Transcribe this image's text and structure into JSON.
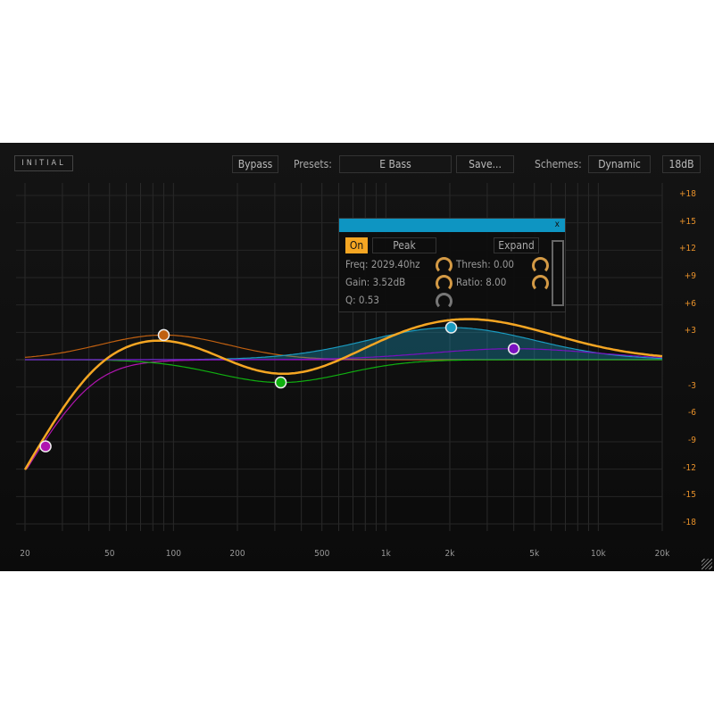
{
  "header": {
    "logo": "INITIAL",
    "bypass": "Bypass",
    "presets_label": "Presets:",
    "preset_value": "E Bass",
    "save": "Save...",
    "schemes_label": "Schemes:",
    "scheme_value": "Dynamic",
    "range": "18dB"
  },
  "popup": {
    "close": "x",
    "on": "On",
    "type": "Peak",
    "expand": "Expand",
    "freq": "Freq: 2029.40hz",
    "gain": "Gain: 3.52dB",
    "q": "Q: 0.53",
    "thresh": "Thresh: 0.00",
    "ratio": "Ratio: 8.00"
  },
  "db_labels": [
    "+18",
    "+15",
    "+12",
    "+9",
    "+6",
    "+3",
    "-3",
    "-6",
    "-9",
    "-12",
    "-15",
    "-18"
  ],
  "freq_labels": [
    "20",
    "50",
    "100",
    "200",
    "500",
    "1k",
    "2k",
    "5k",
    "10k",
    "20k"
  ],
  "bands": [
    {
      "type": "highpass",
      "freq": 40,
      "gain": -9.5,
      "color": "#b015b0"
    },
    {
      "type": "peak",
      "freq": 90,
      "gain": 2.7,
      "color": "#c06010"
    },
    {
      "type": "peak",
      "freq": 320,
      "gain": -2.5,
      "color": "#10b010"
    },
    {
      "type": "peak",
      "freq": 2029.4,
      "gain": 3.52,
      "color": "#1a9bc0"
    },
    {
      "type": "peak",
      "freq": 4000,
      "gain": 1.2,
      "color": "#7a10c0"
    }
  ],
  "colors": {
    "accent": "#f5a623",
    "sum_curve": "#f5a623"
  }
}
